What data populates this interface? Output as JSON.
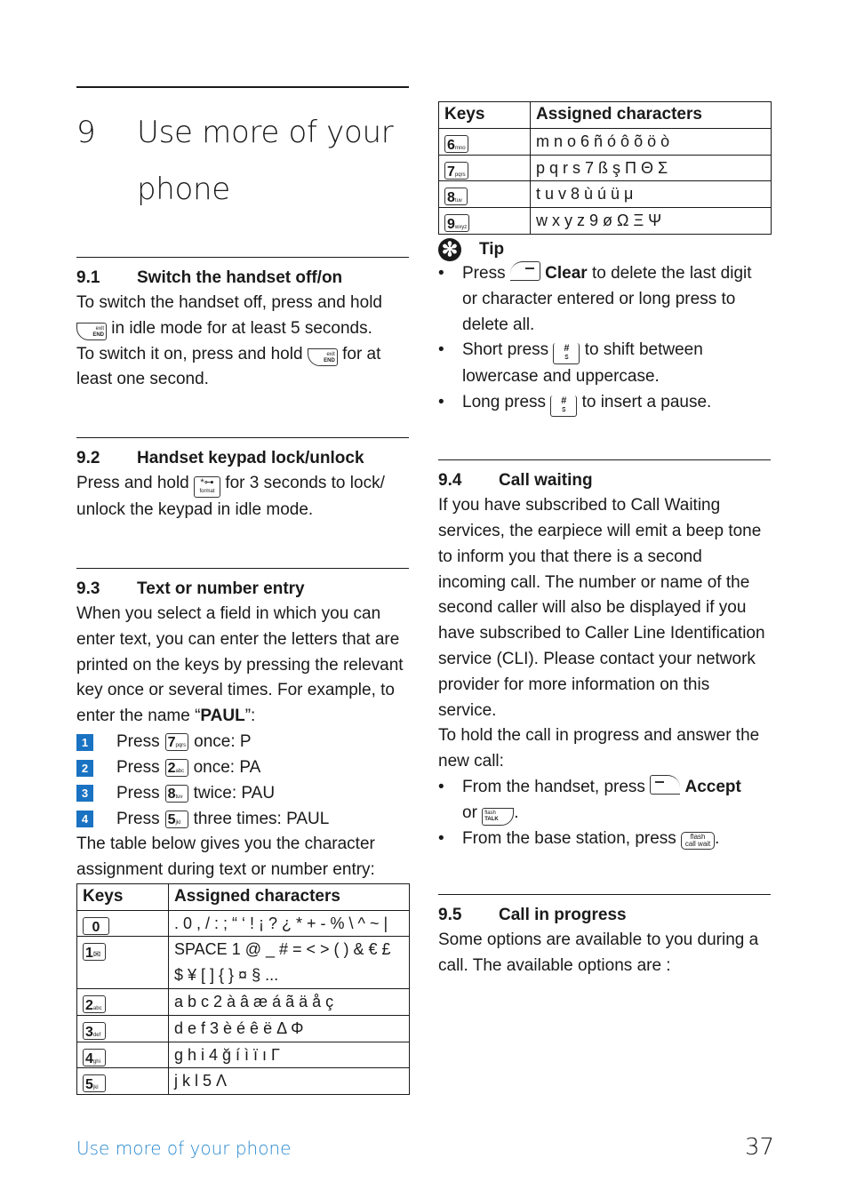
{
  "chapter": {
    "number": "9",
    "title": "Use more of your phone"
  },
  "sections": {
    "s91": {
      "number": "9.1",
      "title": "Switch the handset off/on",
      "text_1": "To switch the handset off, press and hold",
      "text_2": "in idle mode for at least 5 seconds.",
      "text_3": "To switch it on, press and hold",
      "text_4": "for at",
      "text_5": "least one second.",
      "key_label_top": "exit",
      "key_label_bottom": "END"
    },
    "s92": {
      "number": "9.2",
      "title": "Handset keypad lock/unlock",
      "text_1": "Press and hold",
      "text_2": "for 3 seconds to lock/",
      "text_3": "unlock the keypad in idle mode.",
      "key_top": "*⊶",
      "key_bottom": "format"
    },
    "s93": {
      "number": "9.3",
      "title": "Text or number entry",
      "intro": "When you select a field in which you can enter text, you can enter the letters that are printed on the keys by pressing the relevant key once or several times. For example, to enter the name “",
      "intro_bold": "PAUL",
      "intro_end": "”:",
      "steps": [
        {
          "num": "1",
          "verb": "Press",
          "key": "7",
          "key_sub": "pqrs",
          "result": "once: P"
        },
        {
          "num": "2",
          "verb": "Press",
          "key": "2",
          "key_sub": "abc",
          "result": "once: PA"
        },
        {
          "num": "3",
          "verb": "Press",
          "key": "8",
          "key_sub": "tuv",
          "result": "twice: PAU"
        },
        {
          "num": "4",
          "verb": "Press",
          "key": "5",
          "key_sub": "jkl",
          "result": "three times: PAUL"
        }
      ],
      "table_intro": "The table below gives you the character assignment during text or number entry:"
    },
    "s94": {
      "number": "9.4",
      "title": "Call waiting",
      "text": "If you have subscribed to Call Waiting services, the earpiece will emit a beep tone to inform you that there is a second incoming call. The number or name of the second caller will also be displayed if you have subscribed to Caller Line Identification service (CLI). Please contact your network provider for more information on this service.",
      "text_2": "To hold the call in progress and answer the new call:",
      "bullet_1_pre": "From the handset, press",
      "bullet_1_bold": "Accept",
      "bullet_1_or": "or",
      "bullet_1_end": ".",
      "talk_key_top": "flash",
      "talk_key_bottom": "TALK",
      "bullet_2_pre": "From the base station, press",
      "bullet_2_end": ".",
      "cw_key_top": "flash",
      "cw_key_bottom": "call wait"
    },
    "s95": {
      "number": "9.5",
      "title": "Call in progress",
      "text": "Some options are available to you during a call. The available options are :"
    }
  },
  "table_left": {
    "headers": [
      "Keys",
      "Assigned characters"
    ],
    "rows": [
      {
        "key": "0",
        "key_sub": "",
        "chars": ". 0 , / : ;  “ ‘ ! ¡ ? ¿ * + - % \\ ^ ~ |"
      },
      {
        "key": "1",
        "key_sub": "✉",
        "chars": "SPACE 1 @ _ # = < > ( ) & € £ $ ¥ [ ] { } ¤ § ..."
      },
      {
        "key": "2",
        "key_sub": "abc",
        "chars": "a b c 2 à â æ á ã ä å ç"
      },
      {
        "key": "3",
        "key_sub": "def",
        "chars": "d e f 3 è é ê ë Δ Φ"
      },
      {
        "key": "4",
        "key_sub": "ghi",
        "chars": "g h i 4 ğ í ì ï ı Γ"
      },
      {
        "key": "5",
        "key_sub": "jkl",
        "chars": "j k l 5 Λ"
      }
    ]
  },
  "table_right": {
    "headers": [
      "Keys",
      "Assigned characters"
    ],
    "rows": [
      {
        "key": "6",
        "key_sub": "mno",
        "chars": "m n o 6 ñ ó ô õ ö ò"
      },
      {
        "key": "7",
        "key_sub": "pqrs",
        "chars": "p q r s 7 ß ş Π Θ Σ"
      },
      {
        "key": "8",
        "key_sub": "tuv",
        "chars": "t u v 8 ù ú ü μ"
      },
      {
        "key": "9",
        "key_sub": "wxyz",
        "chars": "w x y z 9 ø Ω Ξ Ψ"
      }
    ]
  },
  "tip": {
    "icon": "asterisk-icon",
    "title": "Tip",
    "items": [
      {
        "pre": "Press",
        "bold": "Clear",
        "post": "to delete the last digit or character entered or long press to delete all."
      },
      {
        "pre": "Short press",
        "post": "to shift between lowercase and uppercase."
      },
      {
        "pre": "Long press",
        "post": "to insert a pause."
      }
    ],
    "hash_key_top": "#",
    "hash_key_bottom": "ꜱ"
  },
  "footer": {
    "section": "Use more of your phone",
    "page": "37"
  },
  "colors": {
    "accent": "#1a73c2",
    "footer_link": "#2a8ad0",
    "text": "#1a1a1a"
  }
}
